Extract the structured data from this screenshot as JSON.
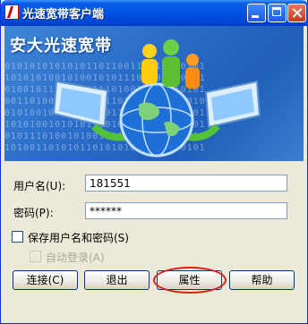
{
  "window": {
    "title": "光速宽带客户端",
    "banner_title": "安大光速宽带",
    "banner_binary": [
      "01010101010101101100111011010101",
      "10101010010100101011100101010101",
      "01001011011010111010010101010101",
      "00110100101000101101010010101010",
      "01010010101111000110101011010101",
      "10101001010101110101010100110101",
      "01011101001010010110101010101011",
      "10100110101011010101011110010101"
    ]
  },
  "form": {
    "username_label": "用户名(U):",
    "username_value": "181551",
    "password_label": "密码(P):",
    "password_value": "******",
    "save_credentials_label": "保存用户名和密码(S)",
    "auto_login_label": "自动登录(A)"
  },
  "buttons": {
    "connect": "连接(C)",
    "exit": "退出",
    "properties": "属性",
    "help": "帮助"
  },
  "colors": {
    "titlebar": "#0054e3",
    "banner": "#2a6cc8",
    "highlight": "#d42020"
  }
}
